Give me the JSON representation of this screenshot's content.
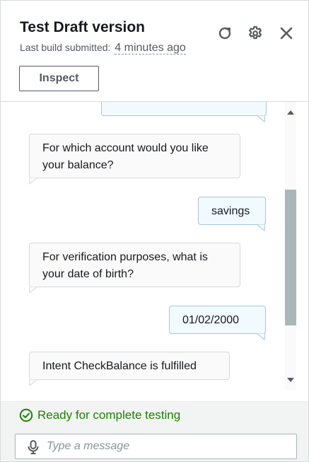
{
  "header": {
    "title": "Test Draft version",
    "subtitle_label": "Last build submitted:",
    "subtitle_time": "4 minutes ago",
    "inspect_label": "Inspect"
  },
  "icons": {
    "refresh": "refresh-icon",
    "settings": "gear-icon",
    "close": "close-icon",
    "status": "check-circle-icon",
    "mic": "microphone-icon"
  },
  "chat": {
    "messages": [
      {
        "role": "user",
        "text": ""
      },
      {
        "role": "bot",
        "text": "For which account would you like your balance?"
      },
      {
        "role": "user",
        "text": "savings"
      },
      {
        "role": "bot",
        "text": "For verification purposes, what is your date of birth?"
      },
      {
        "role": "user",
        "text": "01/02/2000"
      },
      {
        "role": "bot",
        "text": "Intent CheckBalance is fulfilled"
      }
    ]
  },
  "footer": {
    "status_text": "Ready for complete testing",
    "input_placeholder": "Type a message",
    "input_value": ""
  },
  "colors": {
    "success": "#1d8102",
    "user_bubble": "#f1faff",
    "bot_bubble": "#fafafa"
  }
}
